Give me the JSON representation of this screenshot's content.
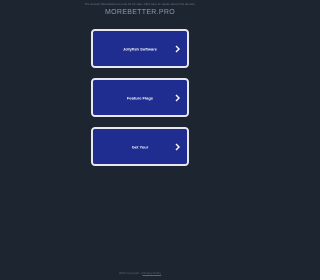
{
  "notice": "The domain Morebetter.pro may be for sale. Click here to inquire about this domain.",
  "domain": "MOREBETTER.PRO",
  "links": [
    {
      "label": "Jellyfish Software",
      "icon": "chevron-right-icon"
    },
    {
      "label": "Feature Flags",
      "icon": "chevron-right-icon"
    },
    {
      "label": "Get Your",
      "icon": "chevron-right-icon"
    }
  ],
  "footer": {
    "copyright": "2025 Copyright.",
    "separator": "|",
    "privacy_link": "Privacy Policy"
  },
  "colors": {
    "background": "#1c2530",
    "card": "#1e2d8f",
    "card_border": "#e6e8ee"
  }
}
